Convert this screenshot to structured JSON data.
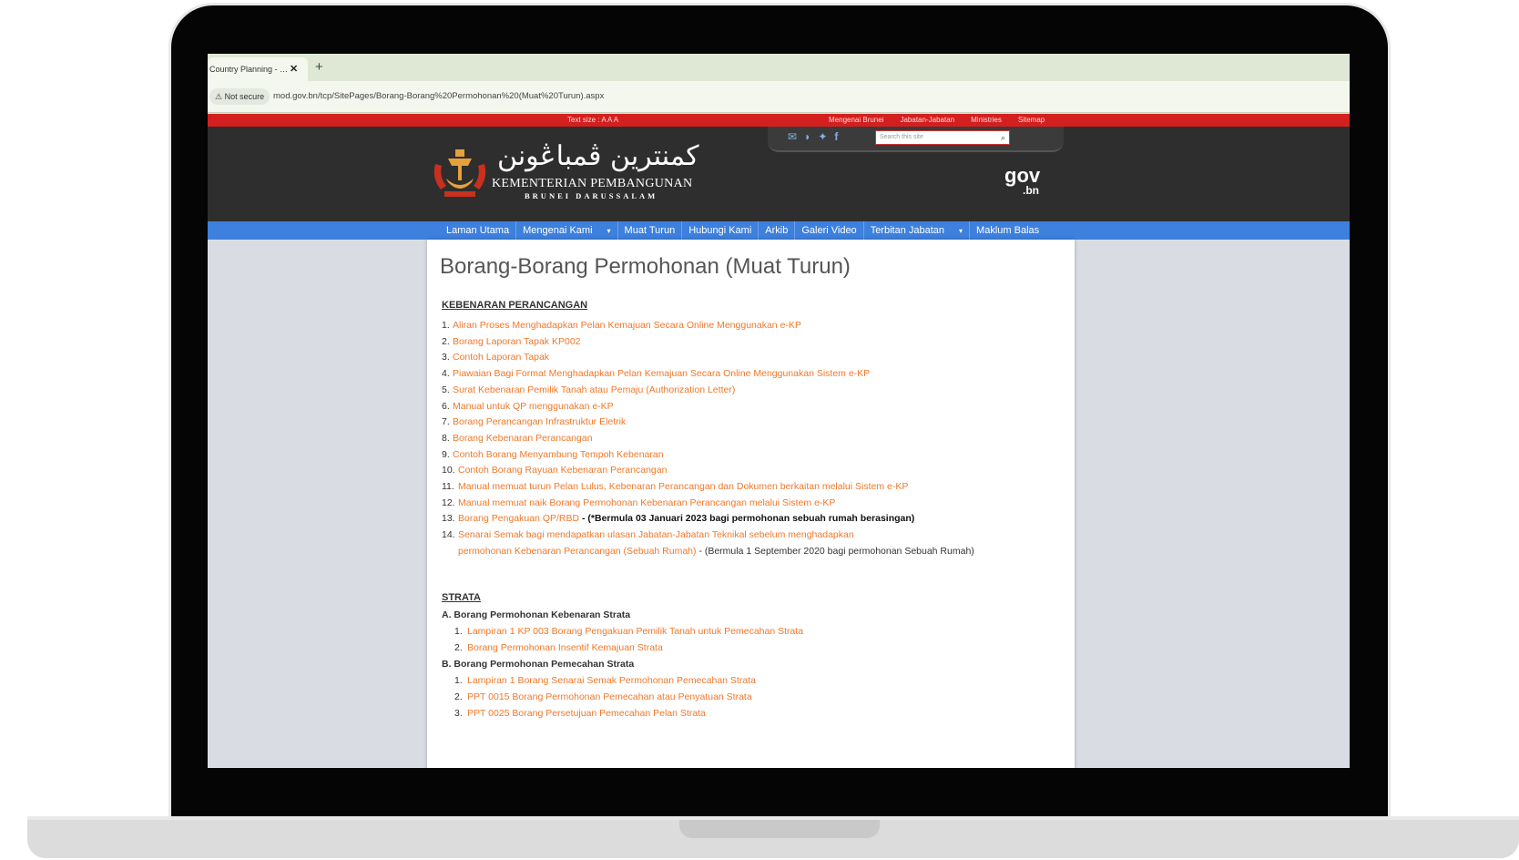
{
  "browser": {
    "tab_title": "Country Planning - …",
    "tab_close": "✕",
    "new_tab": "+",
    "not_secure": "⚠ Not secure",
    "url": "mod.gov.bn/tcp/SitePages/Borang-Borang%20Permohonan%20(Muat%20Turun).aspx"
  },
  "site": {
    "text_size": "Text size : A  A  A",
    "top_links": [
      "Mengenai Brunei",
      "Jabatan-Jabatan",
      "Ministries",
      "Sitemap"
    ],
    "search_placeholder": "Search this site",
    "ministry_jawi": "کمنترين ڤمباڠونن",
    "ministry_name": "KEMENTERIAN PEMBANGUNAN",
    "country": "BRUNEI DARUSSALAM",
    "gov_logo": "gov",
    "gov_logo_suffix": ".bn",
    "nav": [
      "Laman Utama",
      "Mengenai Kami",
      "Muat Turun",
      "Hubungi Kami",
      "Arkib",
      "Galeri Video",
      "Terbitan Jabatan",
      "Maklum Balas"
    ],
    "nav_dropdown": "▾",
    "icons": [
      "mail-icon",
      "rss-icon",
      "twitter-icon",
      "facebook-icon",
      "search-icon"
    ]
  },
  "page": {
    "title": "Borang-Borang Permohonan (Muat Turun)",
    "section1_heading": "KEBENARAN PERANCANGAN",
    "section1_items": [
      {
        "n": "1.",
        "text": "Aliran Proses Menghadapkan Pelan Kemajuan Secara Online Menggunakan e-KP"
      },
      {
        "n": "2.",
        "text": "Borang Laporan Tapak KP002"
      },
      {
        "n": "3.",
        "text": "Contoh Laporan Tapak"
      },
      {
        "n": "4.",
        "text": "Piawaian Bagi Format Menghadapkan Pelan Kemajuan Secara Online Menggunakan Sistem e-KP"
      },
      {
        "n": "5.",
        "text": "Surat Kebenaran Pemilik Tanah atau Pemaju (Authorization Letter)"
      },
      {
        "n": "6.",
        "text": "Manual untuk QP menggunakan e-KP"
      },
      {
        "n": "7.",
        "text": "Borang Perancangan Infrastruktur Eletrik"
      },
      {
        "n": "8.",
        "text": "Borang Kebenaran Perancangan"
      },
      {
        "n": "9.",
        "text": "Contoh Borang Menyambung Tempoh Kebenaran"
      },
      {
        "n": "10.",
        "text": "Contoh Borang Rayuan Kebenaran Perancangan"
      },
      {
        "n": "11.",
        "text": "Manual memuat turun Pelan Lulus, Kebenaran Perancangan dan Dokumen berkaitan melalui Sistem e-KP"
      },
      {
        "n": "12.",
        "text": "Manual memuat naik Borang Permohonan Kebenaran Perancangan melalui Sistem e-KP"
      },
      {
        "n": "13.",
        "text": "Borang Pengakuan QP/RBD",
        "note": " - (*Bermula 03 Januari 2023 bagi permohonan sebuah rumah berasingan)"
      },
      {
        "n": "14.",
        "text": "Senarai Semak bagi mendapatkan ulasan Jabatan-Jabatan Teknikal sebelum menghadapkan",
        "cont": "permohonan Kebenaran Perancangan (Sebuah Rumah)",
        "note": " - (Bermula 1 September 2020 bagi permohonan Sebuah Rumah)"
      }
    ],
    "section2_heading": "STRATA",
    "strata": {
      "a_title": "A. Borang Permohonan Kebenaran Strata",
      "a_items": [
        {
          "n": "1.",
          "text": "Lampiran 1 KP 003 Borang Pengakuan Pemilik Tanah untuk Pemecahan Strata"
        },
        {
          "n": "2.",
          "text": "Borang Permohonan Insentif Kemajuan Strata"
        }
      ],
      "b_title": "B. Borang Permohonan Pemecahan Strata",
      "b_items": [
        {
          "n": "1.",
          "text": "Lampiran 1  Borang Senarai Semak Permohonan Pemecahan Strata"
        },
        {
          "n": "2.",
          "text": "PPT 0015 Borang Permohonan Pemecahan atau Penyatuan Strata"
        },
        {
          "n": "3.",
          "text": "PPT 0025 Borang Persetujuan Pemecahan Pelan Strata"
        }
      ]
    }
  }
}
